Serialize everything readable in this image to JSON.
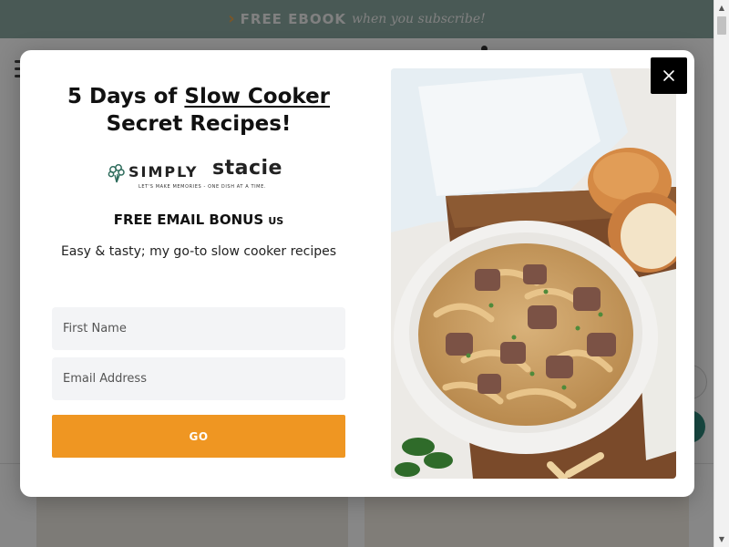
{
  "promo_bar": {
    "highlight": "FREE EBOOK",
    "tagline": "when you subscribe!"
  },
  "modal": {
    "headline_prefix": "5 Days of ",
    "headline_underlined": "Slow Cooker",
    "headline_suffix": "Secret Recipes!",
    "logo": {
      "word1": "SIMPLY",
      "word2": "stacie",
      "tagline": "LET'S MAKE MEMORIES - ONE DISH AT A TIME."
    },
    "bonus_title": "FREE EMAIL BONUS",
    "bonus_suffix": "US",
    "subtitle": "Easy & tasty; my go-to slow cooker recipes",
    "first_name_placeholder": "First Name",
    "email_placeholder": "Email Address",
    "submit_label": "GO",
    "close_icon": "close-icon",
    "image_icon": "beef-stroganoff-photo"
  },
  "colors": {
    "promo_bg": "#8ba9a0",
    "accent_orange": "#ef9622",
    "teal": "#2f8a7e"
  }
}
